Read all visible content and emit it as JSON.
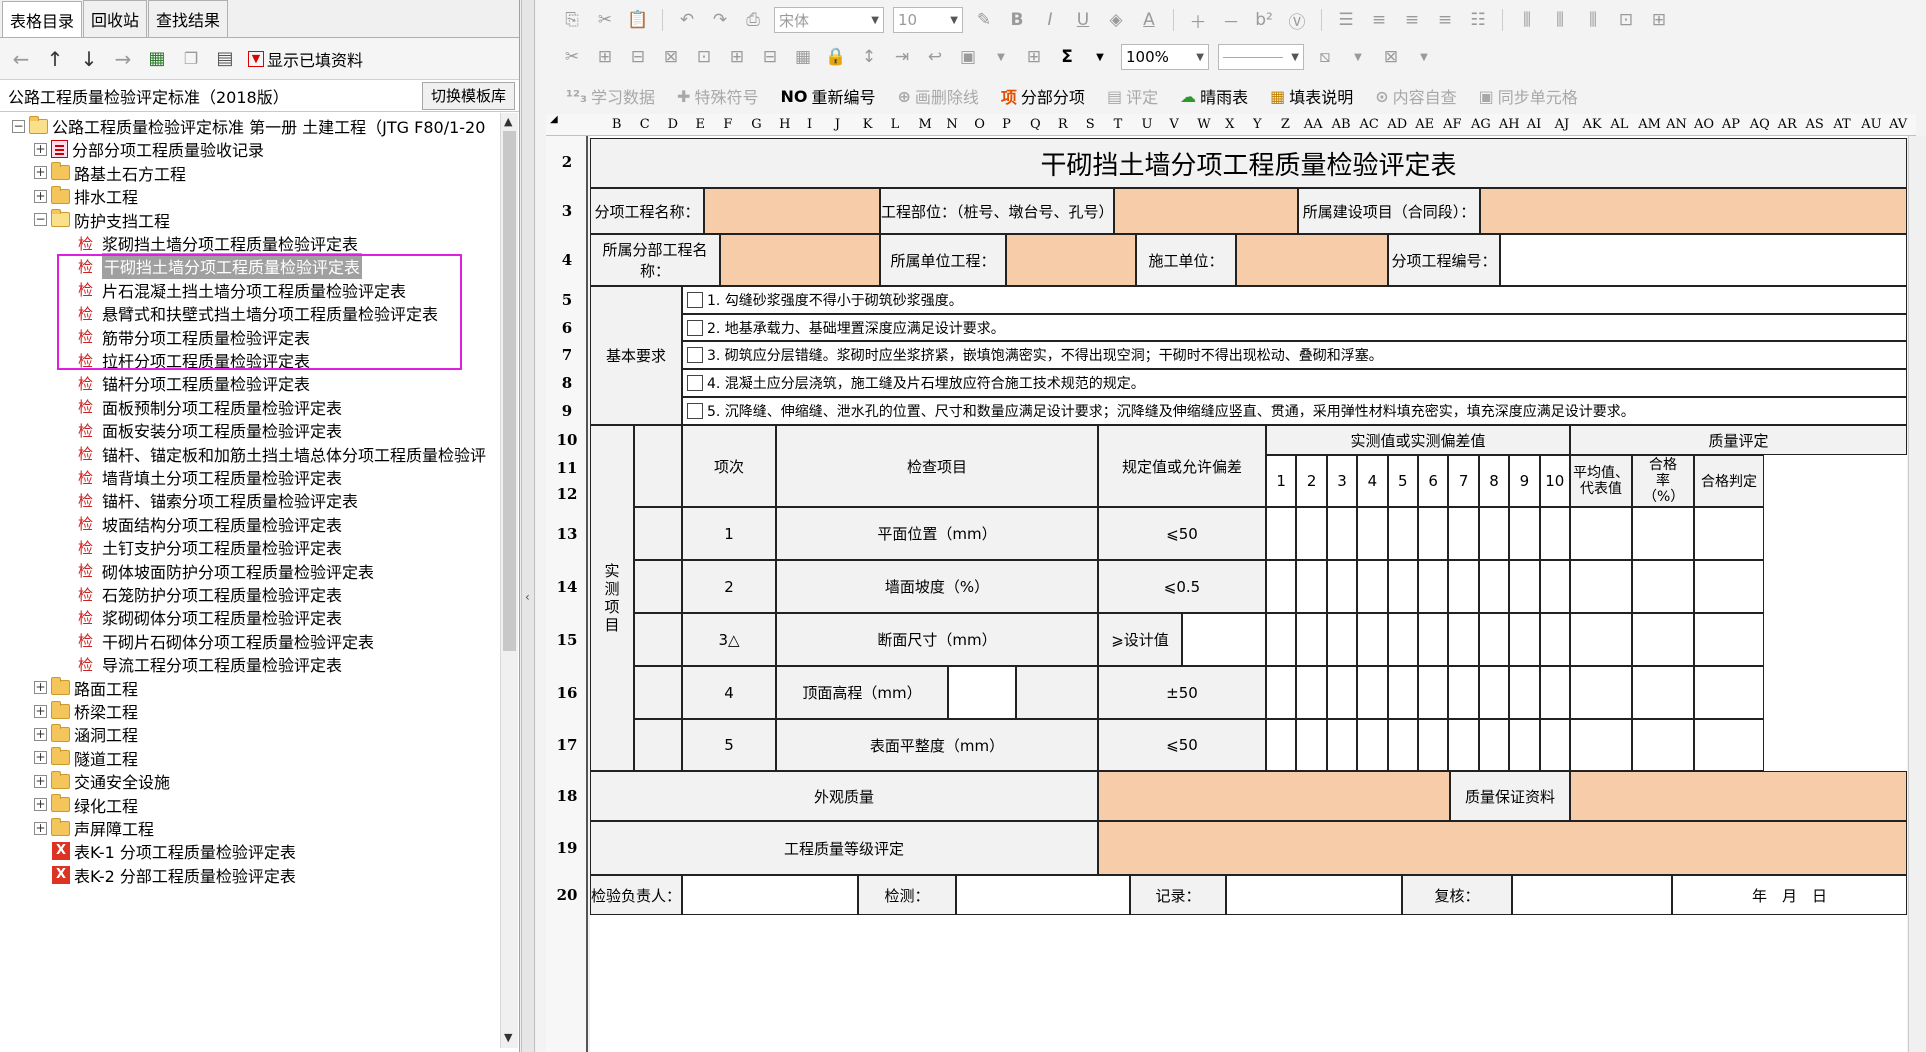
{
  "left_panel": {
    "tabs": [
      "表格目录",
      "回收站",
      "查找结果"
    ],
    "show_filled_label": "显示已填资料",
    "standard": "公路工程质量检验评定标准（2018版）",
    "switch_button": "切换模板库",
    "tree": {
      "root": "公路工程质量检验评定标准 第一册 土建工程（JTG F80/1-20",
      "groups_top": [
        "分部分项工程质量验收记录",
        "路基土石方工程",
        "排水工程"
      ],
      "open_group": "防护支挡工程",
      "jian_mark": "检",
      "items": [
        "浆砌挡土墙分项工程质量检验评定表",
        "干砌挡土墙分项工程质量检验评定表",
        "片石混凝土挡土墙分项工程质量检验评定表",
        "悬臂式和扶壁式挡土墙分项工程质量检验评定表",
        "筋带分项工程质量检验评定表",
        "拉杆分项工程质量检验评定表",
        "锚杆分项工程质量检验评定表",
        "面板预制分项工程质量检验评定表",
        "面板安装分项工程质量检验评定表",
        "锚杆、锚定板和加筋土挡土墙总体分项工程质量检验评",
        "墙背填土分项工程质量检验评定表",
        "锚杆、锚索分项工程质量检验评定表",
        "坡面结构分项工程质量检验评定表",
        "土钉支护分项工程质量检验评定表",
        "砌体坡面防护分项工程质量检验评定表",
        "石笼防护分项工程质量检验评定表",
        "浆砌砌体分项工程质量检验评定表",
        "干砌片石砌体分项工程质量检验评定表",
        "导流工程分项工程质量检验评定表"
      ],
      "groups_bottom": [
        "路面工程",
        "桥梁工程",
        "涵洞工程",
        "隧道工程",
        "交通安全设施",
        "绿化工程",
        "声屏障工程"
      ],
      "tables": [
        "表K-1 分项工程质量检验评定表",
        "表K-2 分部工程质量检验评定表"
      ]
    }
  },
  "toolbar": {
    "font_name": "宋体",
    "font_size": "10",
    "zoom": "100%",
    "sigma": "Σ",
    "buttons3": [
      {
        "icon": "¹²₃",
        "label": "学习数据",
        "on": false
      },
      {
        "icon": "✚",
        "label": "特殊符号",
        "on": false
      },
      {
        "icon": "NO",
        "label": "重新编号",
        "on": true
      },
      {
        "icon": "⊕",
        "label": "画删除线",
        "on": false
      },
      {
        "icon": "项",
        "label": "分部分项",
        "on": true
      },
      {
        "icon": "▤",
        "label": "评定",
        "on": false
      },
      {
        "icon": "☁",
        "label": "晴雨表",
        "on": true
      },
      {
        "icon": "▦",
        "label": "填表说明",
        "on": true
      },
      {
        "icon": "⊙",
        "label": "内容自查",
        "on": false
      },
      {
        "icon": "▣",
        "label": "同步单元格",
        "on": false
      }
    ]
  },
  "sheet": {
    "columns": [
      "B",
      "C",
      "D",
      "E",
      "F",
      "G",
      "H",
      "I",
      "J",
      "K",
      "L",
      "M",
      "N",
      "O",
      "P",
      "Q",
      "R",
      "S",
      "T",
      "U",
      "V",
      "W",
      "X",
      "Y",
      "Z",
      "AA",
      "AB",
      "AC",
      "AD",
      "AE",
      "AF",
      "AG",
      "AH",
      "AI",
      "AJ",
      "AK",
      "AL",
      "AM",
      "AN",
      "AO",
      "AP",
      "AQ",
      "AR",
      "AS",
      "AT",
      "AU",
      "AV"
    ],
    "rows": [
      "2",
      "3",
      "4",
      "5",
      "6",
      "7",
      "8",
      "9",
      "10",
      "11",
      "12",
      "13",
      "14",
      "15",
      "16",
      "17",
      "18",
      "19",
      "20"
    ],
    "title": "干砌挡土墙分项工程质量检验评定表",
    "r3": {
      "a": "分项工程名称：",
      "b": "工程部位：（桩号、墩台号、孔号）",
      "c": "所属建设项目（合同段）："
    },
    "r4": {
      "a": "所属分部工程名称：",
      "b": "所属单位工程：",
      "c": "施工单位：",
      "d": "分项工程编号："
    },
    "basic_label": "基本要求",
    "requirements": [
      "1. 勾缝砂浆强度不得小于砌筑砂浆强度。",
      "2. 地基承载力、基础埋置深度应满足设计要求。",
      "3. 砌筑应分层错缝。浆砌时应坐浆挤紧，嵌填饱满密实，不得出现空洞；干砌时不得出现松动、叠砌和浮塞。",
      "4. 混凝土应分层浇筑，施工缝及片石埋放应符合施工技术规范的规定。",
      "5. 沉降缝、伸缩缝、泄水孔的位置、尺寸和数量应满足设计要求；沉降缝及伸缩缝应竖直、贯通，采用弹性材料填充密实，填充深度应满足设计要求。"
    ],
    "headers": {
      "item_no": "项次",
      "check_item": "检查项目",
      "spec": "规定值或允许偏差",
      "measured": "实测值或实测偏差值",
      "nums": [
        "1",
        "2",
        "3",
        "4",
        "5",
        "6",
        "7",
        "8",
        "9",
        "10"
      ],
      "quality": "质量评定",
      "avg": "平均值、代表值",
      "pass_rate": "合格率（%）",
      "judge": "合格判定"
    },
    "measured_label": "实测项目",
    "items": [
      {
        "no": "1",
        "name": "平面位置（mm）",
        "spec": "⩽50"
      },
      {
        "no": "2",
        "name": "墙面坡度（%）",
        "spec": "⩽0.5"
      },
      {
        "no": "3△",
        "name": "断面尺寸（mm）",
        "spec": "⩾设计值"
      },
      {
        "no": "4",
        "name": "顶面高程（mm）",
        "spec": "±50"
      },
      {
        "no": "5",
        "name": "表面平整度（mm）",
        "spec": "⩽50"
      }
    ],
    "r18": {
      "a": "外观质量",
      "b": "质量保证资料"
    },
    "r19": "工程质量等级评定",
    "r20": {
      "a": "检验负责人：",
      "b": "检测：",
      "c": "记录：",
      "d": "复核：",
      "date": "年　月　日"
    }
  },
  "colors": {
    "fill_orange": "#f6cda8",
    "highlight": "#e020e0",
    "selected": "#a0a0a0"
  }
}
